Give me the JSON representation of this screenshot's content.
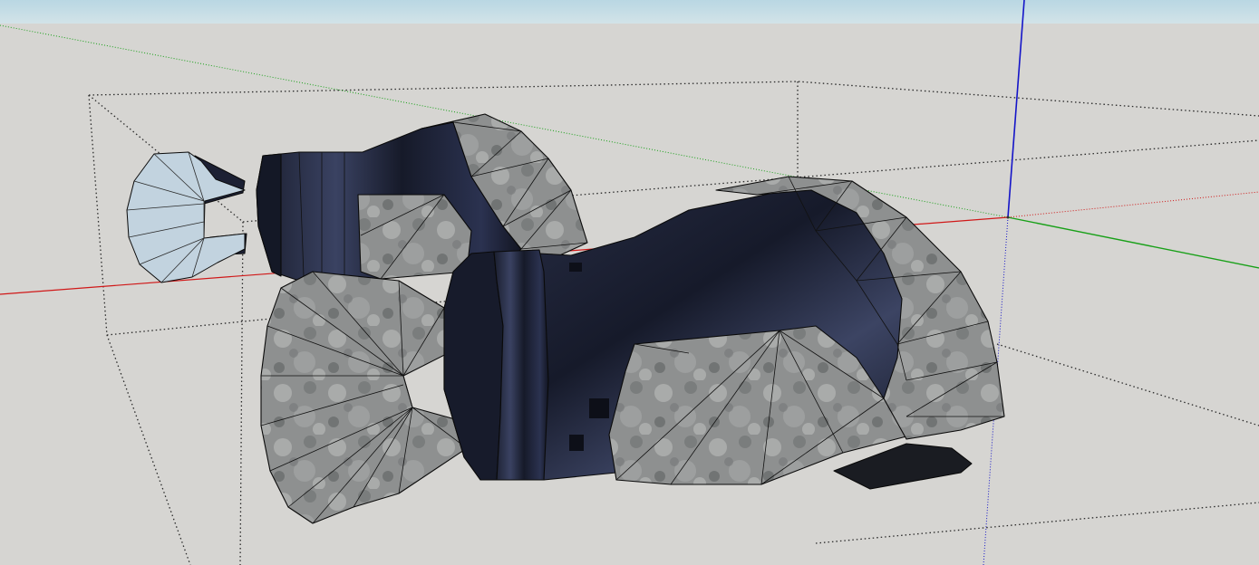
{
  "viewport": {
    "sky_color": "#c6dde6",
    "ground_color": "#d6d5d2",
    "axis_colors": {
      "red": "#d01818",
      "green": "#18a018",
      "blue": "#1414c8"
    }
  },
  "materials": {
    "metal": "#8d8f8f",
    "metal_light": "#b3b5b4",
    "metal_dark": "#5d5f60",
    "fabric": "#1c2033",
    "fabric_highlight": "#4a5376",
    "selected_face": "#c2d3df",
    "edge": "#0a0a0a"
  },
  "icons": {
    "origin": "axes-origin-icon"
  }
}
